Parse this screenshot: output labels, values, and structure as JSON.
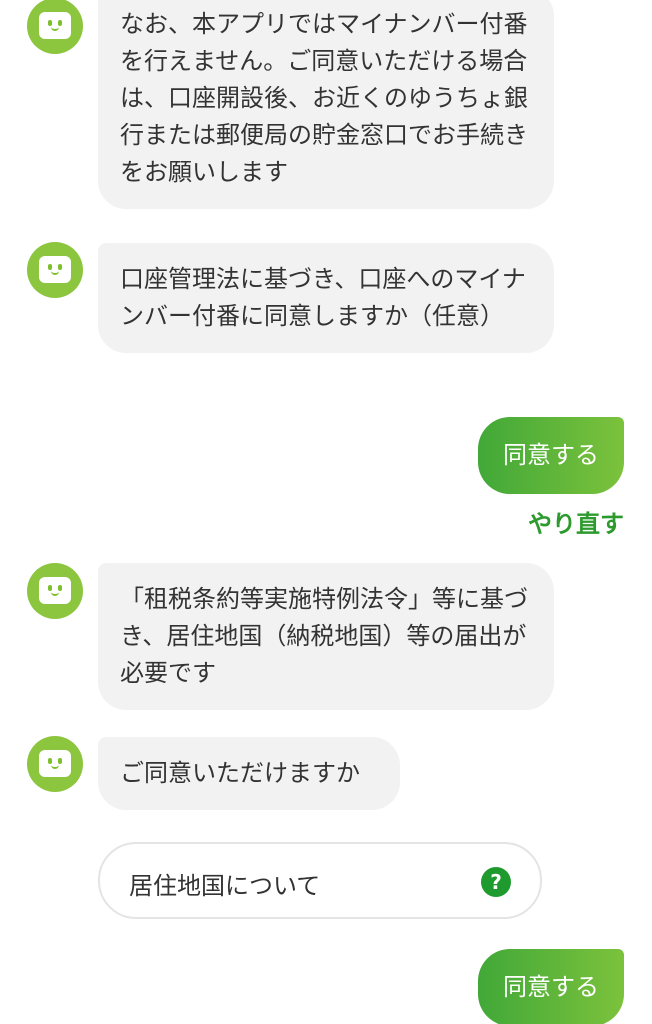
{
  "messages": [
    {
      "sender": "bot",
      "text": "なお、本アプリではマイナンバー付番を行えません。ご同意いただける場合は、口座開設後、お近くのゆうちょ銀行または郵便局の貯金窓口でお手続きをお願いします"
    },
    {
      "sender": "bot",
      "text": "口座管理法に基づき、口座へのマイナンバー付番に同意しますか（任意）"
    },
    {
      "sender": "user",
      "text": "同意する"
    },
    {
      "sender": "bot",
      "text": "「租税条約等実施特例法令」等に基づき、居住地国（納税地国）等の届出が必要です"
    },
    {
      "sender": "bot",
      "text": "ご同意いただけますか"
    },
    {
      "sender": "user",
      "text": "同意する"
    }
  ],
  "redo_label": "やり直す",
  "info_card": {
    "label": "居住地国について",
    "help_glyph": "?"
  },
  "colors": {
    "avatar": "#8cc63f",
    "bubble_bg": "#f2f2f2",
    "reply_gradient_start": "#41a838",
    "reply_gradient_end": "#7cc23c",
    "redo_text": "#2c9a2c",
    "help_icon": "#1f9a2f"
  },
  "icons": {
    "avatar": "robot-face-icon",
    "help": "question-circle-icon"
  }
}
